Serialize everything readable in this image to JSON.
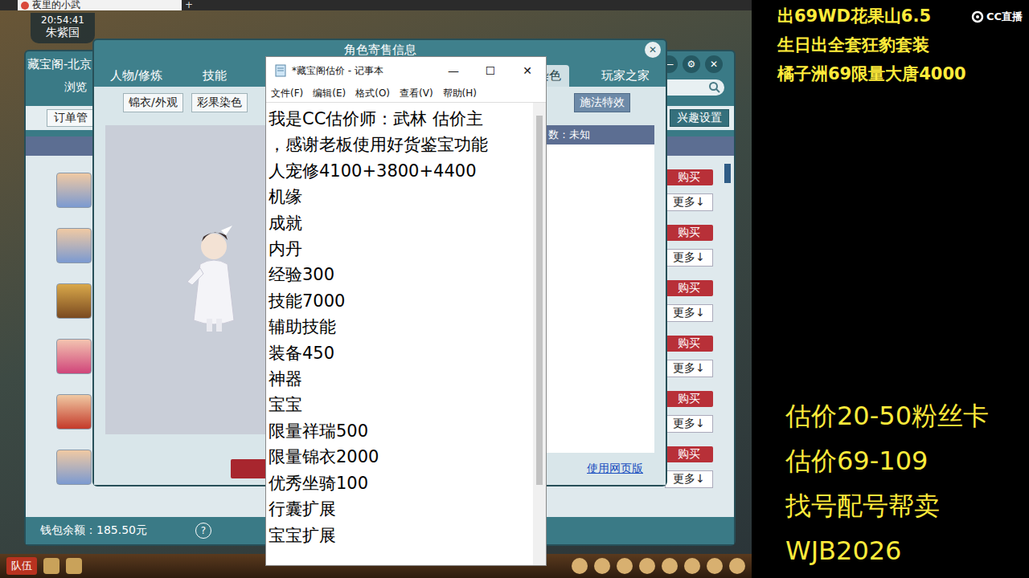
{
  "browser_tab": {
    "title": "夜里的小武",
    "add": "+"
  },
  "hud": {
    "time": "20:54:41",
    "location": "朱紫国"
  },
  "market_window": {
    "title": "藏宝阁-北京",
    "controls": [
      "—",
      "⚙",
      "✕"
    ],
    "tab": "浏览",
    "order_button": "订单管",
    "interest_button": "兴趣设置",
    "rows": [
      {
        "buy": "购买",
        "more": "更多↓"
      },
      {
        "buy": "购买",
        "more": "更多↓"
      },
      {
        "buy": "购买",
        "more": "更多↓"
      },
      {
        "buy": "购买",
        "more": "更多↓"
      },
      {
        "buy": "购买",
        "more": "更多↓"
      },
      {
        "buy": "购买",
        "more": "更多↓"
      }
    ],
    "wallet": "钱包余额：185.50元",
    "help": "?"
  },
  "detail_window": {
    "title": "角色寄售信息",
    "close": "✕",
    "tabs": [
      {
        "label": "人物/修炼",
        "selected": false
      },
      {
        "label": "技能",
        "selected": false
      },
      {
        "label": "染色",
        "selected": true
      },
      {
        "label": "玩家之家",
        "selected": false
      }
    ],
    "subtabs": [
      {
        "label": "锦衣/外观",
        "selected": false
      },
      {
        "label": "彩果染色",
        "selected": false
      },
      {
        "label": "施法特效",
        "selected": true
      }
    ],
    "info": "数：未知",
    "web_link": "使用网页版"
  },
  "notepad": {
    "title": "*藏宝阁估价 - 记事本",
    "controls": [
      "—",
      "☐",
      "✕"
    ],
    "menu": [
      "文件(F)",
      "编辑(E)",
      "格式(O)",
      "查看(V)",
      "帮助(H)"
    ],
    "lines": [
      "我是CC估价师：武林 估价主",
      "，感谢老板使用好货鉴宝功能",
      "人宠修4100+3800+4400",
      "机缘",
      "成就",
      "内丹",
      "经验300",
      "技能7000",
      "辅助技能",
      "装备450",
      "神器",
      "宝宝",
      "限量祥瑞500",
      "限量锦衣2000",
      "优秀坐骑100",
      "行囊扩展",
      "宝宝扩展"
    ]
  },
  "stream_overlay": {
    "ads": [
      "出69WD花果山6.5",
      "生日出全套狂豹套装",
      "橘子洲69限量大唐4000"
    ],
    "logo": "CC直播",
    "promo": [
      "估价20-50粉丝卡",
      "估价69-109",
      "找号配号帮卖",
      "WJB2026"
    ]
  },
  "hotbar": {
    "team": "队伍"
  }
}
